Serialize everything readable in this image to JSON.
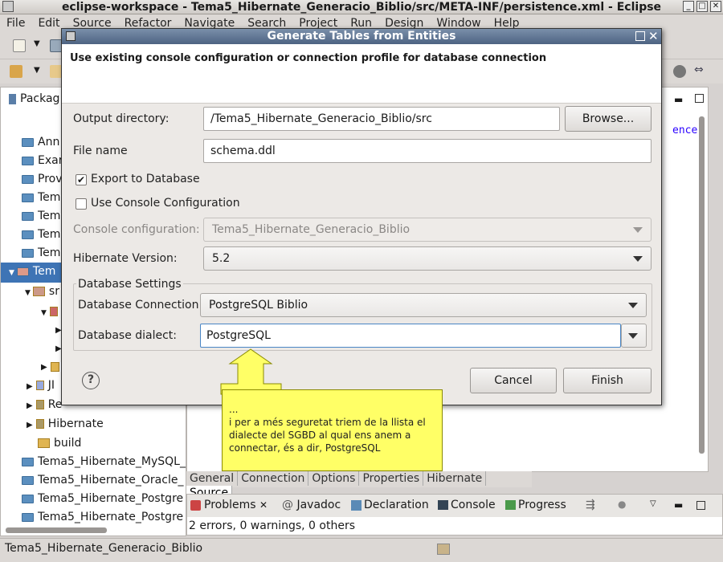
{
  "window": {
    "title": "eclipse-workspace - Tema5_Hibernate_Generacio_Biblio/src/META-INF/persistence.xml - Eclipse"
  },
  "menu": [
    "File",
    "Edit",
    "Source",
    "Refactor",
    "Navigate",
    "Search",
    "Project",
    "Run",
    "Design",
    "Window",
    "Help"
  ],
  "package_explorer": {
    "tab_label": "Packag",
    "items": [
      {
        "label": "Ann",
        "selected": false
      },
      {
        "label": "Exar",
        "selected": false
      },
      {
        "label": "Prov",
        "selected": false
      },
      {
        "label": "Tem",
        "selected": false
      },
      {
        "label": "Tem",
        "selected": false
      },
      {
        "label": "Tem",
        "selected": false
      },
      {
        "label": "Tem",
        "selected": false
      },
      {
        "label": "Tem",
        "selected": true
      },
      {
        "label": "sr",
        "selected": false
      },
      {
        "label": "JI",
        "selected": false
      },
      {
        "label": "Re",
        "selected": false
      },
      {
        "label": "Hibernate",
        "selected": false
      },
      {
        "label": "build",
        "selected": false
      },
      {
        "label": "Tema5_Hibernate_MySQL_",
        "selected": false
      },
      {
        "label": "Tema5_Hibernate_Oracle_",
        "selected": false
      },
      {
        "label": "Tema5_Hibernate_Postgre",
        "selected": false
      },
      {
        "label": "Tema5_Hibernate_Postgre",
        "selected": false
      }
    ]
  },
  "editor": {
    "snippet": "ence\"",
    "tabs": [
      "General",
      "Connection",
      "Options",
      "Properties",
      "Hibernate",
      "Source"
    ],
    "active_tab": "Source"
  },
  "bottom_panel": {
    "tabs": [
      "Problems",
      "Javadoc",
      "Declaration",
      "Console",
      "Progress"
    ],
    "status": "2 errors, 0 warnings, 0 others"
  },
  "statusbar": {
    "text": "Tema5_Hibernate_Generacio_Biblio"
  },
  "dialog": {
    "title": "Generate Tables from Entities",
    "message": "Use existing console configuration or connection profile for database connection",
    "output_directory_label": "Output directory:",
    "output_directory_value": "/Tema5_Hibernate_Generacio_Biblio/src",
    "browse_label": "Browse...",
    "file_name_label": "File name",
    "file_name_value": "schema.ddl",
    "export_to_db_label": "Export to Database",
    "export_to_db_checked": true,
    "use_console_label": "Use Console Configuration",
    "use_console_checked": false,
    "console_config_label": "Console configuration:",
    "console_config_value": "Tema5_Hibernate_Generacio_Biblio",
    "hibernate_version_label": "Hibernate Version:",
    "hibernate_version_value": "5.2",
    "db_settings_label": "Database Settings",
    "db_connection_label": "Database Connection",
    "db_connection_value": "PostgreSQL Biblio",
    "db_dialect_label": "Database dialect:",
    "db_dialect_value": "PostgreSQL",
    "cancel_label": "Cancel",
    "finish_label": "Finish",
    "help_glyph": "?"
  },
  "callout": {
    "text": "...\ni per a més seguretat triem de la llista el dialecte del SGBD al qual ens anem a connectar, és a dir, PostgreSQL"
  }
}
